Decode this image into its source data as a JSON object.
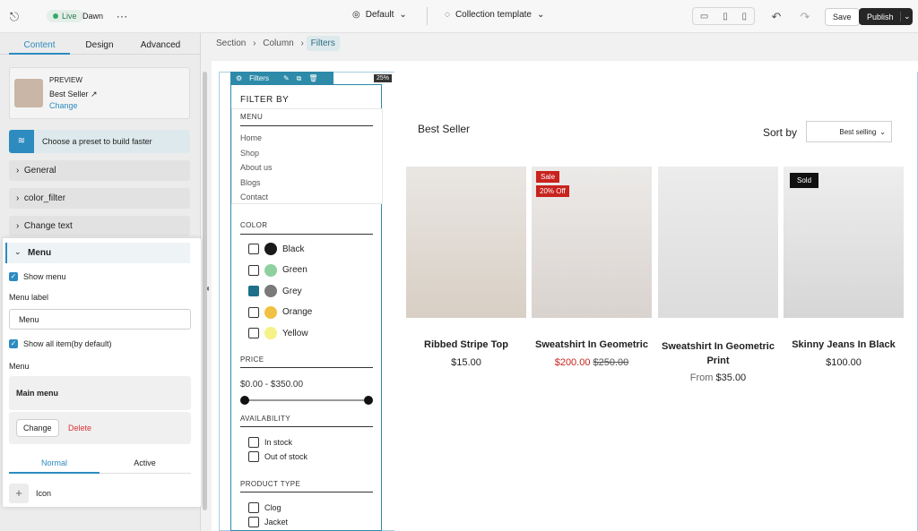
{
  "topbar": {
    "live": "Live",
    "theme": "Dawn",
    "theme_select": "Default",
    "template_select": "Collection template",
    "save": "Save",
    "publish": "Publish"
  },
  "leftpanel": {
    "tabs": [
      "Content",
      "Design",
      "Advanced"
    ],
    "preview": {
      "title": "PREVIEW",
      "product": "Best Seller",
      "change": "Change"
    },
    "preset": "Choose a preset to build faster",
    "accordions": [
      "General",
      "color_filter",
      "Change text"
    ],
    "menu_card": {
      "title": "Menu",
      "show_menu": "Show menu",
      "menu_label_title": "Menu label",
      "menu_label_value": "Menu",
      "show_all": "Show all item(by default)",
      "menu_title": "Menu",
      "main_menu": "Main menu",
      "change": "Change",
      "delete": "Delete",
      "tabs": [
        "Normal",
        "Active"
      ],
      "icon": "Icon"
    }
  },
  "breadcrumb": [
    "Section",
    "Column",
    "Filters"
  ],
  "canvas": {
    "toolbar": {
      "label": "Filters",
      "percent": "25%"
    },
    "filter_by": "FILTER BY",
    "menu": {
      "title": "MENU",
      "items": [
        "Home",
        "Shop",
        "About us",
        "Blogs",
        "Contact"
      ]
    },
    "color": {
      "title": "COLOR",
      "items": [
        {
          "name": "Black",
          "swatch": "#1a1a1a",
          "checked": false
        },
        {
          "name": "Green",
          "swatch": "#8fd19e",
          "checked": false
        },
        {
          "name": "Grey",
          "swatch": "#7a7a7a",
          "checked": true
        },
        {
          "name": "Orange",
          "swatch": "#f0c142",
          "checked": false
        },
        {
          "name": "Yellow",
          "swatch": "#f5f287",
          "checked": false
        }
      ]
    },
    "price": {
      "title": "PRICE",
      "range": "$0.00 - $350.00"
    },
    "availability": {
      "title": "AVAILABILITY",
      "items": [
        "In stock",
        "Out of stock"
      ]
    },
    "product_type": {
      "title": "PRODUCT TYPE",
      "items": [
        "Clog",
        "Jacket"
      ]
    },
    "collection_title": "Best Seller",
    "sort_label": "Sort by",
    "sort_value": "Best selling",
    "products": [
      {
        "name": "Ribbed Stripe Top",
        "price": "$15.00",
        "compare": "",
        "badges": []
      },
      {
        "name": "Sweatshirt In Geometric",
        "price": "$200.00",
        "compare": "$250.00",
        "badges": [
          "Sale",
          "20% Off"
        ]
      },
      {
        "name": "Sweatshirt In Geometric Print",
        "price": "$35.00",
        "compare": "",
        "prefix": "From",
        "badges": []
      },
      {
        "name": "Skinny Jeans In Black",
        "price": "$100.00",
        "compare": "",
        "badges": [
          "Sold"
        ]
      }
    ]
  }
}
